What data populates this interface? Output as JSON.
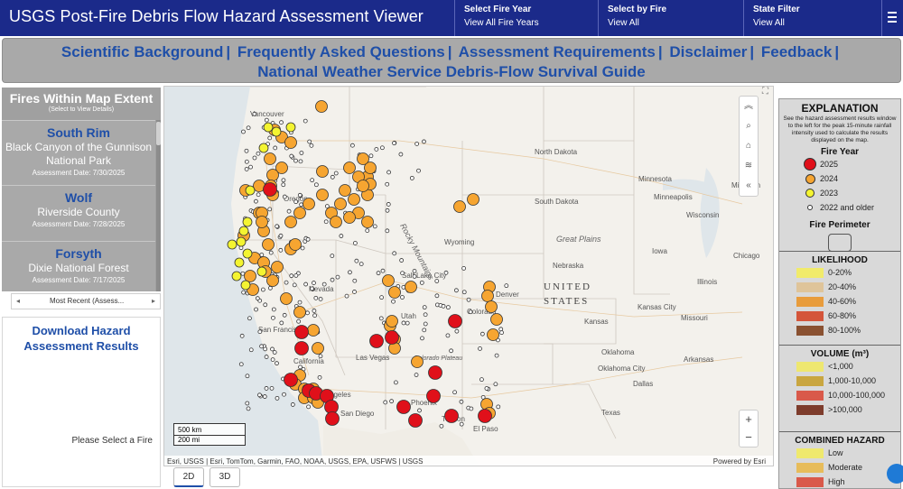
{
  "header": {
    "title": "USGS Post-Fire Debris Flow Hazard Assessment Viewer",
    "filters": [
      {
        "title": "Select Fire Year",
        "value": "View All Fire Years"
      },
      {
        "title": "Select by Fire",
        "value": "View All"
      },
      {
        "title": "State Filter",
        "value": "View All"
      }
    ],
    "menu_icon": "hamburger-menu-icon"
  },
  "banner": {
    "row1": [
      "Scientific Background",
      "Frequently Asked Questions",
      "Assessment Requirements",
      "Disclaimer",
      "Feedback"
    ],
    "row2": "National Weather Service Debris-Flow Survival Guide"
  },
  "fire_list": {
    "title": "Fires Within Map Extent",
    "subtitle": "(Select to View Details)",
    "items": [
      {
        "name": "South Rim",
        "location": "Black Canyon of the Gunnison National Park",
        "date": "Assessment Date: 7/30/2025"
      },
      {
        "name": "Wolf",
        "location": "Riverside County",
        "date": "Assessment Date: 7/28/2025"
      },
      {
        "name": "Forsyth",
        "location": "Dixie National Forest",
        "date": "Assessment Date: 7/17/2025"
      }
    ],
    "sort_label": "Most Recent (Assess..."
  },
  "download": {
    "title": "Download Hazard Assessment Results",
    "placeholder": "Please Select a Fire"
  },
  "map": {
    "labels": {
      "vancouver": "Vancouver",
      "north_dakota": "North Dakota",
      "south_dakota": "South Dakota",
      "minnesota": "Minnesota",
      "minneapolis": "Minneapolis",
      "wisconsin": "Wisconsin",
      "michigan": "Michigan",
      "wyoming": "Wyoming",
      "great_plains": "Great Plains",
      "nebraska": "Nebraska",
      "iowa": "Iowa",
      "illinois": "Illinois",
      "chicago": "Chicago",
      "united": "UNITED",
      "states": "STATES",
      "salt_lake_city": "Salt Lake City",
      "denver": "Denver",
      "colorado": "Colorado",
      "kansas": "Kansas",
      "kansas_city": "Kansas City",
      "missouri": "Missouri",
      "las_vegas": "Las Vegas",
      "san_francisco": "San Francisco",
      "california": "California",
      "los_angeles": "Los Angeles",
      "san_diego": "San Diego",
      "phoenix": "Phoenix",
      "tucson": "Tucson",
      "el_paso": "El Paso",
      "oklahoma": "Oklahoma",
      "oklahoma_city": "Oklahoma City",
      "arkansas": "Arkansas",
      "dallas": "Dallas",
      "texas": "Texas",
      "oregon": "Oregon",
      "nevada": "Nevada",
      "utah": "Utah",
      "rocky_mountains": "Rocky Mountains",
      "colorado_plateau": "Colorado Plateau"
    },
    "scale_km": "500 km",
    "scale_mi": "200 mi",
    "attribution": "Esri, USGS | Esri, TomTom, Garmin, FAO, NOAA, USGS, EPA, USFWS | USGS",
    "powered_by": "Powered by Esri",
    "tools": [
      "chevrons-up-icon",
      "search-icon",
      "home-icon",
      "layers-icon",
      "chevrons-left-icon"
    ],
    "zoom_in": "+",
    "zoom_out": "−",
    "view_2d": "2D",
    "view_3d": "3D"
  },
  "legend": {
    "title": "EXPLANATION",
    "note": "See the hazard assessment results window to the left for the peak 15-minute rainfall intensity used to calculate the results displayed on the map.",
    "fire_year_title": "Fire Year",
    "fire_years": [
      {
        "label": "2025",
        "color": "#e0101a"
      },
      {
        "label": "2024",
        "color": "#f6a531"
      },
      {
        "label": "2023",
        "color": "#f4f431"
      },
      {
        "label": "2022 and older",
        "color": "#ffffff"
      }
    ],
    "perimeter_title": "Fire Perimeter",
    "likelihood_title": "LIKELIHOOD",
    "likelihood": [
      {
        "label": "0-20%",
        "color": "#f1eb6b"
      },
      {
        "label": "20-40%",
        "color": "#dfc49a"
      },
      {
        "label": "40-60%",
        "color": "#e89c3c"
      },
      {
        "label": "60-80%",
        "color": "#d4553a"
      },
      {
        "label": "80-100%",
        "color": "#8a5131"
      }
    ],
    "volume_title": "VOLUME (m³)",
    "volume": [
      {
        "label": "<1,000",
        "color": "#eee770"
      },
      {
        "label": "1,000-10,000",
        "color": "#c9a640"
      },
      {
        "label": "10,000-100,000",
        "color": "#d9594a"
      },
      {
        "label": ">100,000",
        "color": "#7d3c2c"
      }
    ],
    "combined_title": "COMBINED HAZARD",
    "combined": [
      {
        "label": "Low",
        "color": "#efe96e"
      },
      {
        "label": "Moderate",
        "color": "#e7bc5a"
      },
      {
        "label": "High",
        "color": "#d9594a"
      }
    ]
  },
  "colors": {
    "header_bg": "#1b2a8a",
    "link": "#1f4fa8",
    "banner_bg": "#a9a9a9"
  }
}
